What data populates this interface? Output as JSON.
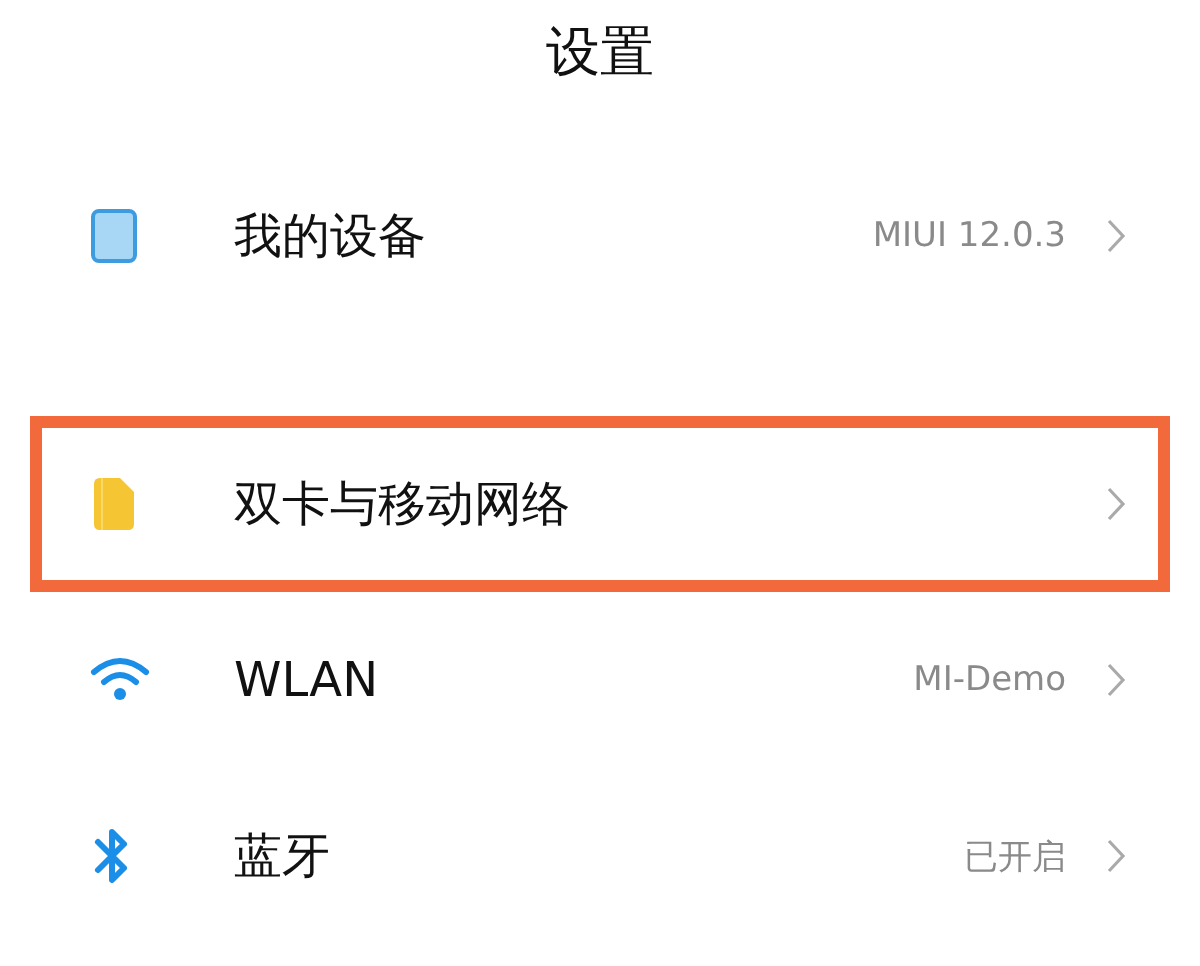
{
  "title": "设置",
  "sections": [
    {
      "items": [
        {
          "label": "我的设备",
          "value": "MIUI 12.0.3",
          "highlighted": false
        }
      ]
    },
    {
      "items": [
        {
          "label": "双卡与移动网络",
          "highlighted": true
        },
        {
          "label": "WLAN",
          "value": "MI-Demo",
          "highlighted": false
        },
        {
          "label": "蓝牙",
          "value": "已开启",
          "highlighted": false
        }
      ]
    }
  ]
}
